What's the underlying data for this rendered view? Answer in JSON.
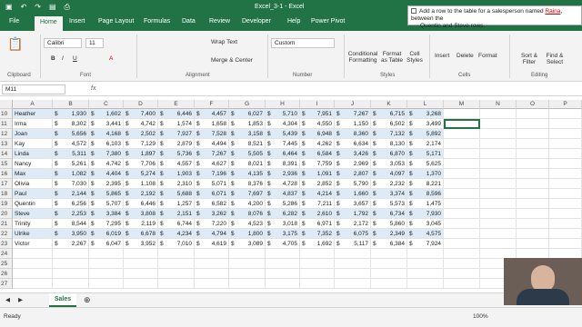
{
  "window": {
    "title": "Excel_3-1  -  Excel",
    "user": "Tell me"
  },
  "quick_access": [
    "save",
    "undo",
    "redo",
    "open",
    "print"
  ],
  "ribbon_tabs": [
    "File",
    "Home",
    "Insert",
    "Page Layout",
    "Formulas",
    "Data",
    "Review",
    "Developer",
    "Help",
    "Power Pivot"
  ],
  "ribbon": {
    "clipboard": "Clipboard",
    "font": "Font",
    "font_name": "Calibri",
    "font_size": "11",
    "alignment": "Alignment",
    "wrap_text": "Wrap Text",
    "merge_center": "Merge & Center",
    "number": "Number",
    "number_format": "Custom",
    "styles": "Styles",
    "cond_format": "Conditional Formatting",
    "format_table": "Format as Table",
    "cell_styles": "Cell Styles",
    "cells": "Cells",
    "insert": "Insert",
    "delete": "Delete",
    "format": "Format",
    "editing": "Editing",
    "sort_filter": "Sort & Filter",
    "find_select": "Find & Select"
  },
  "tell_me": {
    "line1": "Add a row to the table for a salesperson named",
    "highlight": "Raina",
    "line1b": ", between the",
    "line2": "Quentin and Steve rows."
  },
  "name_box": "M11",
  "fx_label": "fx",
  "columns": [
    "A",
    "B",
    "C",
    "D",
    "E",
    "F",
    "G",
    "H",
    "I",
    "J",
    "K",
    "L",
    "M",
    "N",
    "O",
    "P"
  ],
  "rows": [
    {
      "n": "10",
      "name": "Heather",
      "v": [
        "1,930",
        "1,602",
        "7,400",
        "6,446",
        "4,457",
        "6,027",
        "5,710",
        "7,951",
        "7,267",
        "6,715",
        "3,268"
      ]
    },
    {
      "n": "11",
      "name": "Irma",
      "v": [
        "8,302",
        "3,441",
        "4,742",
        "1,574",
        "1,658",
        "1,853",
        "4,304",
        "4,550",
        "1,150",
        "6,502",
        "3,499"
      ]
    },
    {
      "n": "12",
      "name": "Joan",
      "v": [
        "5,656",
        "4,168",
        "2,502",
        "7,927",
        "7,528",
        "3,158",
        "5,439",
        "6,948",
        "8,360",
        "7,132",
        "5,892"
      ]
    },
    {
      "n": "13",
      "name": "Kay",
      "v": [
        "4,572",
        "6,103",
        "7,129",
        "2,879",
        "4,494",
        "8,521",
        "7,445",
        "4,262",
        "6,634",
        "8,130",
        "2,174"
      ]
    },
    {
      "n": "14",
      "name": "Linda",
      "v": [
        "5,311",
        "7,380",
        "1,897",
        "5,736",
        "7,267",
        "5,505",
        "6,464",
        "6,584",
        "3,426",
        "6,870",
        "5,171"
      ]
    },
    {
      "n": "15",
      "name": "Nancy",
      "v": [
        "5,261",
        "4,742",
        "7,706",
        "4,557",
        "4,627",
        "8,021",
        "8,391",
        "7,759",
        "2,969",
        "3,053",
        "5,625"
      ]
    },
    {
      "n": "16",
      "name": "Max",
      "v": [
        "1,082",
        "4,404",
        "5,274",
        "1,903",
        "7,196",
        "4,135",
        "2,936",
        "1,091",
        "2,807",
        "4,097",
        "1,370"
      ]
    },
    {
      "n": "17",
      "name": "Olivia",
      "v": [
        "7,030",
        "2,395",
        "1,108",
        "2,310",
        "5,071",
        "8,376",
        "4,728",
        "2,852",
        "5,790",
        "2,232",
        "8,221"
      ]
    },
    {
      "n": "18",
      "name": "Paul",
      "v": [
        "2,144",
        "5,865",
        "2,192",
        "5,688",
        "6,071",
        "7,697",
        "4,837",
        "4,214",
        "1,660",
        "3,374",
        "8,596"
      ]
    },
    {
      "n": "19",
      "name": "Quentin",
      "v": [
        "6,256",
        "5,707",
        "6,446",
        "1,257",
        "6,582",
        "4,200",
        "5,286",
        "7,211",
        "3,657",
        "5,573",
        "1,475"
      ]
    },
    {
      "n": "20",
      "name": "Steve",
      "v": [
        "2,253",
        "3,384",
        "3,808",
        "2,151",
        "3,262",
        "8,076",
        "6,282",
        "2,610",
        "1,792",
        "6,734",
        "7,930"
      ]
    },
    {
      "n": "21",
      "name": "Trinity",
      "v": [
        "8,544",
        "7,295",
        "2,119",
        "6,744",
        "7,220",
        "4,523",
        "3,018",
        "6,971",
        "2,172",
        "5,860",
        "3,045"
      ]
    },
    {
      "n": "22",
      "name": "Ulrike",
      "v": [
        "3,950",
        "6,019",
        "6,678",
        "4,234",
        "4,794",
        "1,800",
        "3,175",
        "7,352",
        "6,075",
        "2,349",
        "4,575"
      ]
    },
    {
      "n": "23",
      "name": "Victor",
      "v": [
        "2,267",
        "6,047",
        "3,952",
        "7,010",
        "4,619",
        "3,089",
        "4,705",
        "1,692",
        "5,117",
        "6,384",
        "7,924"
      ]
    }
  ],
  "empty_rows": [
    "24",
    "25",
    "26",
    "27",
    "28",
    "29",
    "30",
    "31",
    "32",
    "33",
    "34",
    "35"
  ],
  "currency": "$",
  "sheet_tab": "Sales",
  "status": {
    "ready": "Ready",
    "zoom": "100%"
  }
}
